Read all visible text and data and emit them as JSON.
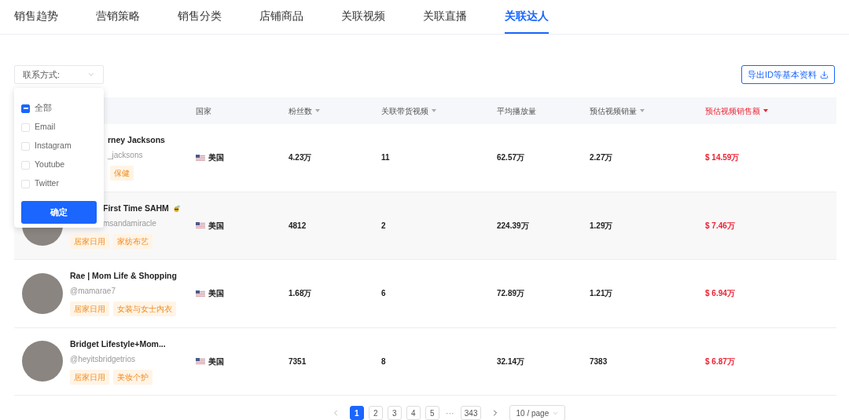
{
  "tabs": [
    {
      "label": "销售趋势",
      "selected": false
    },
    {
      "label": "营销策略",
      "selected": false
    },
    {
      "label": "销售分类",
      "selected": false
    },
    {
      "label": "店铺商品",
      "selected": false
    },
    {
      "label": "关联视频",
      "selected": false
    },
    {
      "label": "关联直播",
      "selected": false
    },
    {
      "label": "关联达人",
      "selected": true
    }
  ],
  "filter": {
    "label": "联系方式:"
  },
  "export_button": "导出ID等基本资料",
  "dropdown": {
    "options": [
      {
        "label": "全部",
        "checked": false,
        "indeterminate": true
      },
      {
        "label": "Email",
        "checked": false,
        "indeterminate": false
      },
      {
        "label": "Instagram",
        "checked": false,
        "indeterminate": false
      },
      {
        "label": "Youtube",
        "checked": false,
        "indeterminate": false
      },
      {
        "label": "Twitter",
        "checked": false,
        "indeterminate": false
      }
    ],
    "confirm": "确定"
  },
  "table": {
    "columns": [
      {
        "label": "国家",
        "sortable": false,
        "selected": false
      },
      {
        "label": "粉丝数",
        "sortable": true,
        "selected": false
      },
      {
        "label": "关联带货视频",
        "sortable": true,
        "selected": false
      },
      {
        "label": "平均播放量",
        "sortable": false,
        "selected": false
      },
      {
        "label": "预估视频销量",
        "sortable": true,
        "selected": false
      },
      {
        "label": "预估视频销售额",
        "sortable": true,
        "selected": true
      }
    ],
    "rows": [
      {
        "kind": "hidden",
        "hovered": false,
        "creator": {
          "name": "rney Jacksons",
          "handle": "_jacksons",
          "tags": [
            "保健"
          ],
          "badge": false
        },
        "cells": [
          "美国",
          "4.23万",
          "11",
          "62.57万",
          "2.27万",
          "$ 14.59万"
        ]
      },
      {
        "kind": "partial",
        "hovered": true,
        "creator": {
          "name": "First Time SAHM",
          "handle": "msandamiracle",
          "tags": [
            "居家日用",
            "家纺布艺"
          ],
          "badge": true
        },
        "cells": [
          "美国",
          "4812",
          "2",
          "224.39万",
          "1.29万",
          "$ 7.46万"
        ]
      },
      {
        "kind": "plain",
        "hovered": false,
        "creator": {
          "name": "Rae | Mom Life & Shopping",
          "handle": "@mamarae7",
          "tags": [
            "居家日用",
            "女装与女士内衣"
          ],
          "badge": false
        },
        "cells": [
          "美国",
          "1.68万",
          "6",
          "72.89万",
          "1.21万",
          "$ 6.94万"
        ]
      },
      {
        "kind": "plain",
        "hovered": false,
        "creator": {
          "name": "Bridget Lifestyle+Mom...",
          "handle": "@heyitsbridgetrios",
          "tags": [
            "居家日用",
            "美妆个护"
          ],
          "badge": false
        },
        "cells": [
          "美国",
          "7351",
          "8",
          "32.14万",
          "7383",
          "$ 6.87万"
        ]
      }
    ]
  },
  "pagination": {
    "pages": [
      {
        "kind": "page",
        "label": "1",
        "selected": true
      },
      {
        "kind": "page",
        "label": "2",
        "selected": false
      },
      {
        "kind": "page",
        "label": "3",
        "selected": false
      },
      {
        "kind": "page",
        "label": "4",
        "selected": false
      },
      {
        "kind": "page",
        "label": "5",
        "selected": false
      },
      {
        "kind": "ellipsis",
        "label": "···",
        "selected": false
      },
      {
        "kind": "page",
        "label": "343",
        "selected": false
      }
    ],
    "page_size": "10 / page"
  }
}
